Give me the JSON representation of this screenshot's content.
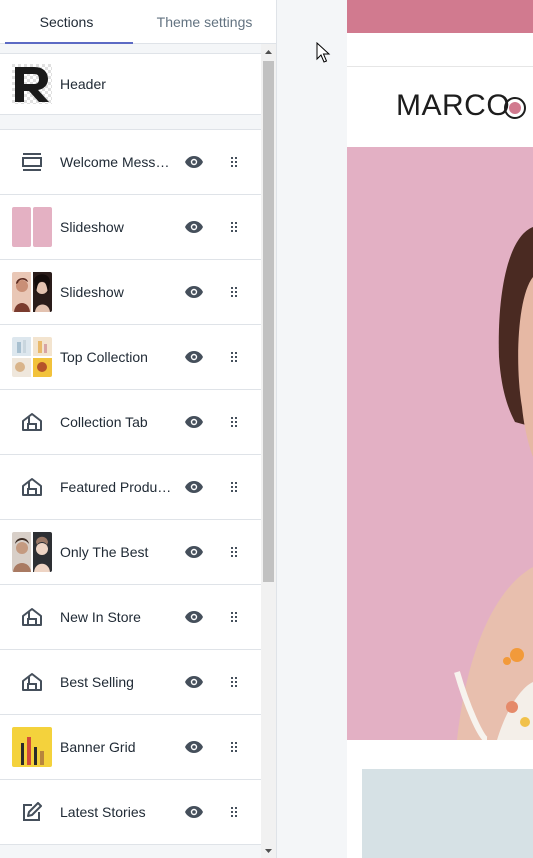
{
  "tabs": {
    "sections": "Sections",
    "theme_settings": "Theme settings"
  },
  "header_section": {
    "label": "Header",
    "icon": "logo-r-thumbnail"
  },
  "sections": [
    {
      "label": "Welcome Message",
      "icon": "section-outline-icon"
    },
    {
      "label": "Slideshow",
      "icon": "pink-slides-thumbnail"
    },
    {
      "label": "Slideshow",
      "icon": "model-photo-thumbnail"
    },
    {
      "label": "Top Collection",
      "icon": "collection-grid-thumbnail"
    },
    {
      "label": "Collection Tab",
      "icon": "store-icon"
    },
    {
      "label": "Featured Products",
      "icon": "store-icon"
    },
    {
      "label": "Only The Best",
      "icon": "portrait-thumbnail"
    },
    {
      "label": "New In Store",
      "icon": "store-icon"
    },
    {
      "label": "Best Selling",
      "icon": "store-icon"
    },
    {
      "label": "Banner Grid",
      "icon": "banner-thumbnail"
    },
    {
      "label": "Latest Stories",
      "icon": "edit-icon"
    }
  ],
  "preview": {
    "logo_text": "MARCO",
    "colors": {
      "announcement_bar": "#d17a8f",
      "hero_background": "#e3b0c4"
    }
  },
  "colors": {
    "tab_accent": "#5c6ac4",
    "icon": "#454f5b"
  }
}
